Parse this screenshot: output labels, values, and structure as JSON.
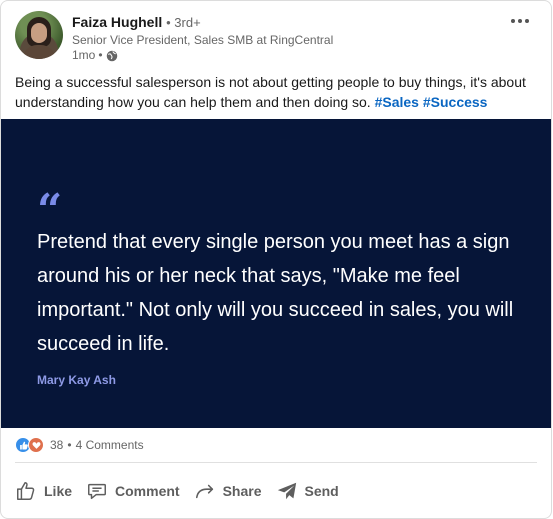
{
  "post": {
    "author": {
      "name": "Faiza Hughell",
      "degree": "3rd+",
      "headline": "Senior Vice President, Sales SMB at RingCentral",
      "time": "1mo"
    },
    "text_before": "Being a successful salesperson is not about getting people to buy things, it's about understanding how you can help them and then doing so.",
    "hashtags": [
      "#Sales",
      "#Success"
    ],
    "quote_image": {
      "quote_mark": "“",
      "text": "Pretend that every single person you meet has a sign around his or her neck that says, \"Make me feel important.\" Not only will you succeed in sales, you will succeed in life.",
      "author": "Mary Kay Ash",
      "background_color": "#061538",
      "accent_color": "#7a8be8"
    },
    "social": {
      "reaction_count": "38",
      "separator": "•",
      "comments": "4 Comments",
      "reactions": [
        "like-icon",
        "love-icon"
      ]
    },
    "actions": {
      "like": "Like",
      "comment": "Comment",
      "share": "Share",
      "send": "Send"
    }
  },
  "colors": {
    "link": "#0a66c2",
    "muted": "#666666"
  }
}
